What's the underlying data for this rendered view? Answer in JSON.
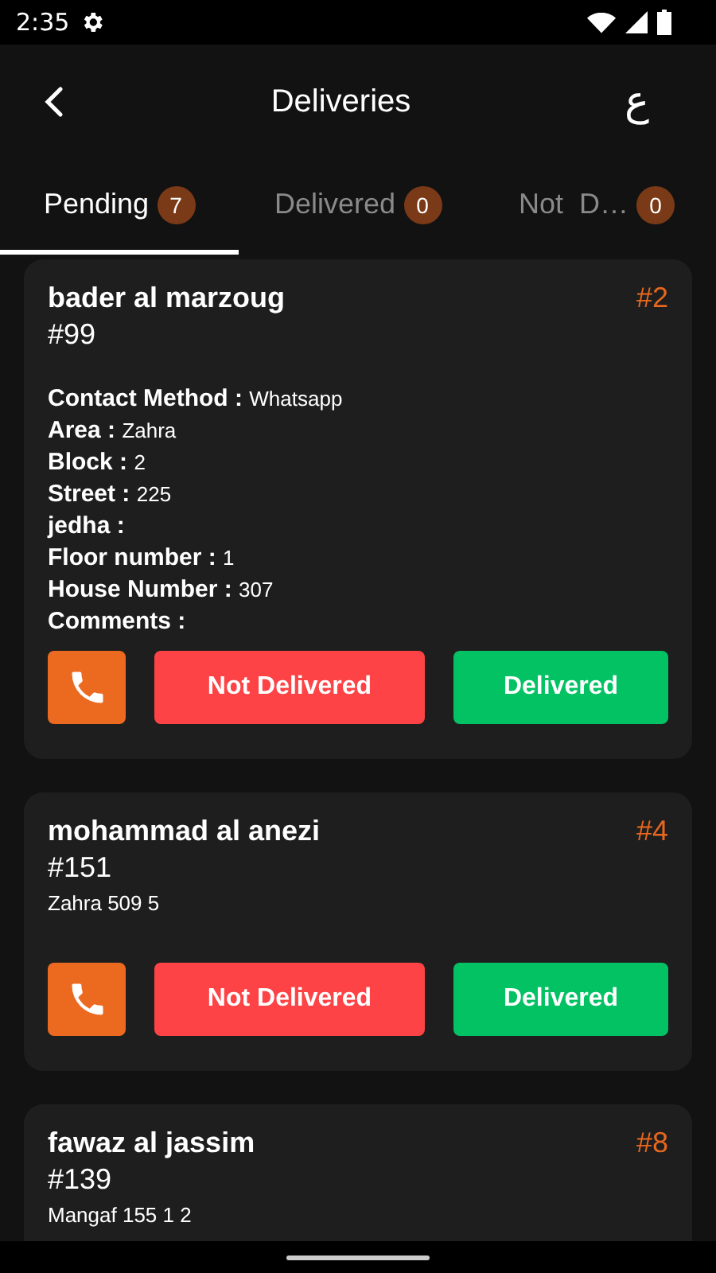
{
  "status_bar": {
    "time": "2:35"
  },
  "app_bar": {
    "title": "Deliveries",
    "language_button": "ع"
  },
  "tabs": [
    {
      "label": "Pending",
      "count": "7",
      "selected": true
    },
    {
      "label": "Delivered",
      "count": "0",
      "selected": false
    },
    {
      "label": "Not  D…",
      "count": "0",
      "selected": false
    }
  ],
  "orders": [
    {
      "kind": "details",
      "customer": "bader al marzoug",
      "order_number": "#99",
      "position": "#2",
      "fields": [
        {
          "label": "Contact Method :",
          "value": "Whatsapp"
        },
        {
          "label": "Area :",
          "value": "Zahra"
        },
        {
          "label": "Block :",
          "value": "2"
        },
        {
          "label": "Street :",
          "value": "225"
        },
        {
          "label": "jedha :"
        },
        {
          "label": "Floor number :",
          "value": "1"
        },
        {
          "label": "House Number :",
          "value": "307"
        },
        {
          "label": "Comments :"
        }
      ],
      "buttons": [
        "Not Delivered",
        "Delivered"
      ]
    },
    {
      "kind": "address",
      "customer": "mohammad al anezi",
      "order_number": "#151",
      "position": "#4",
      "address": "Zahra 509 5",
      "buttons": [
        "Not Delivered",
        "Delivered"
      ]
    },
    {
      "kind": "address",
      "customer": "fawaz al jassim",
      "order_number": "#139",
      "position": "#8",
      "address": "Mangaf 155 1 2"
    }
  ]
}
